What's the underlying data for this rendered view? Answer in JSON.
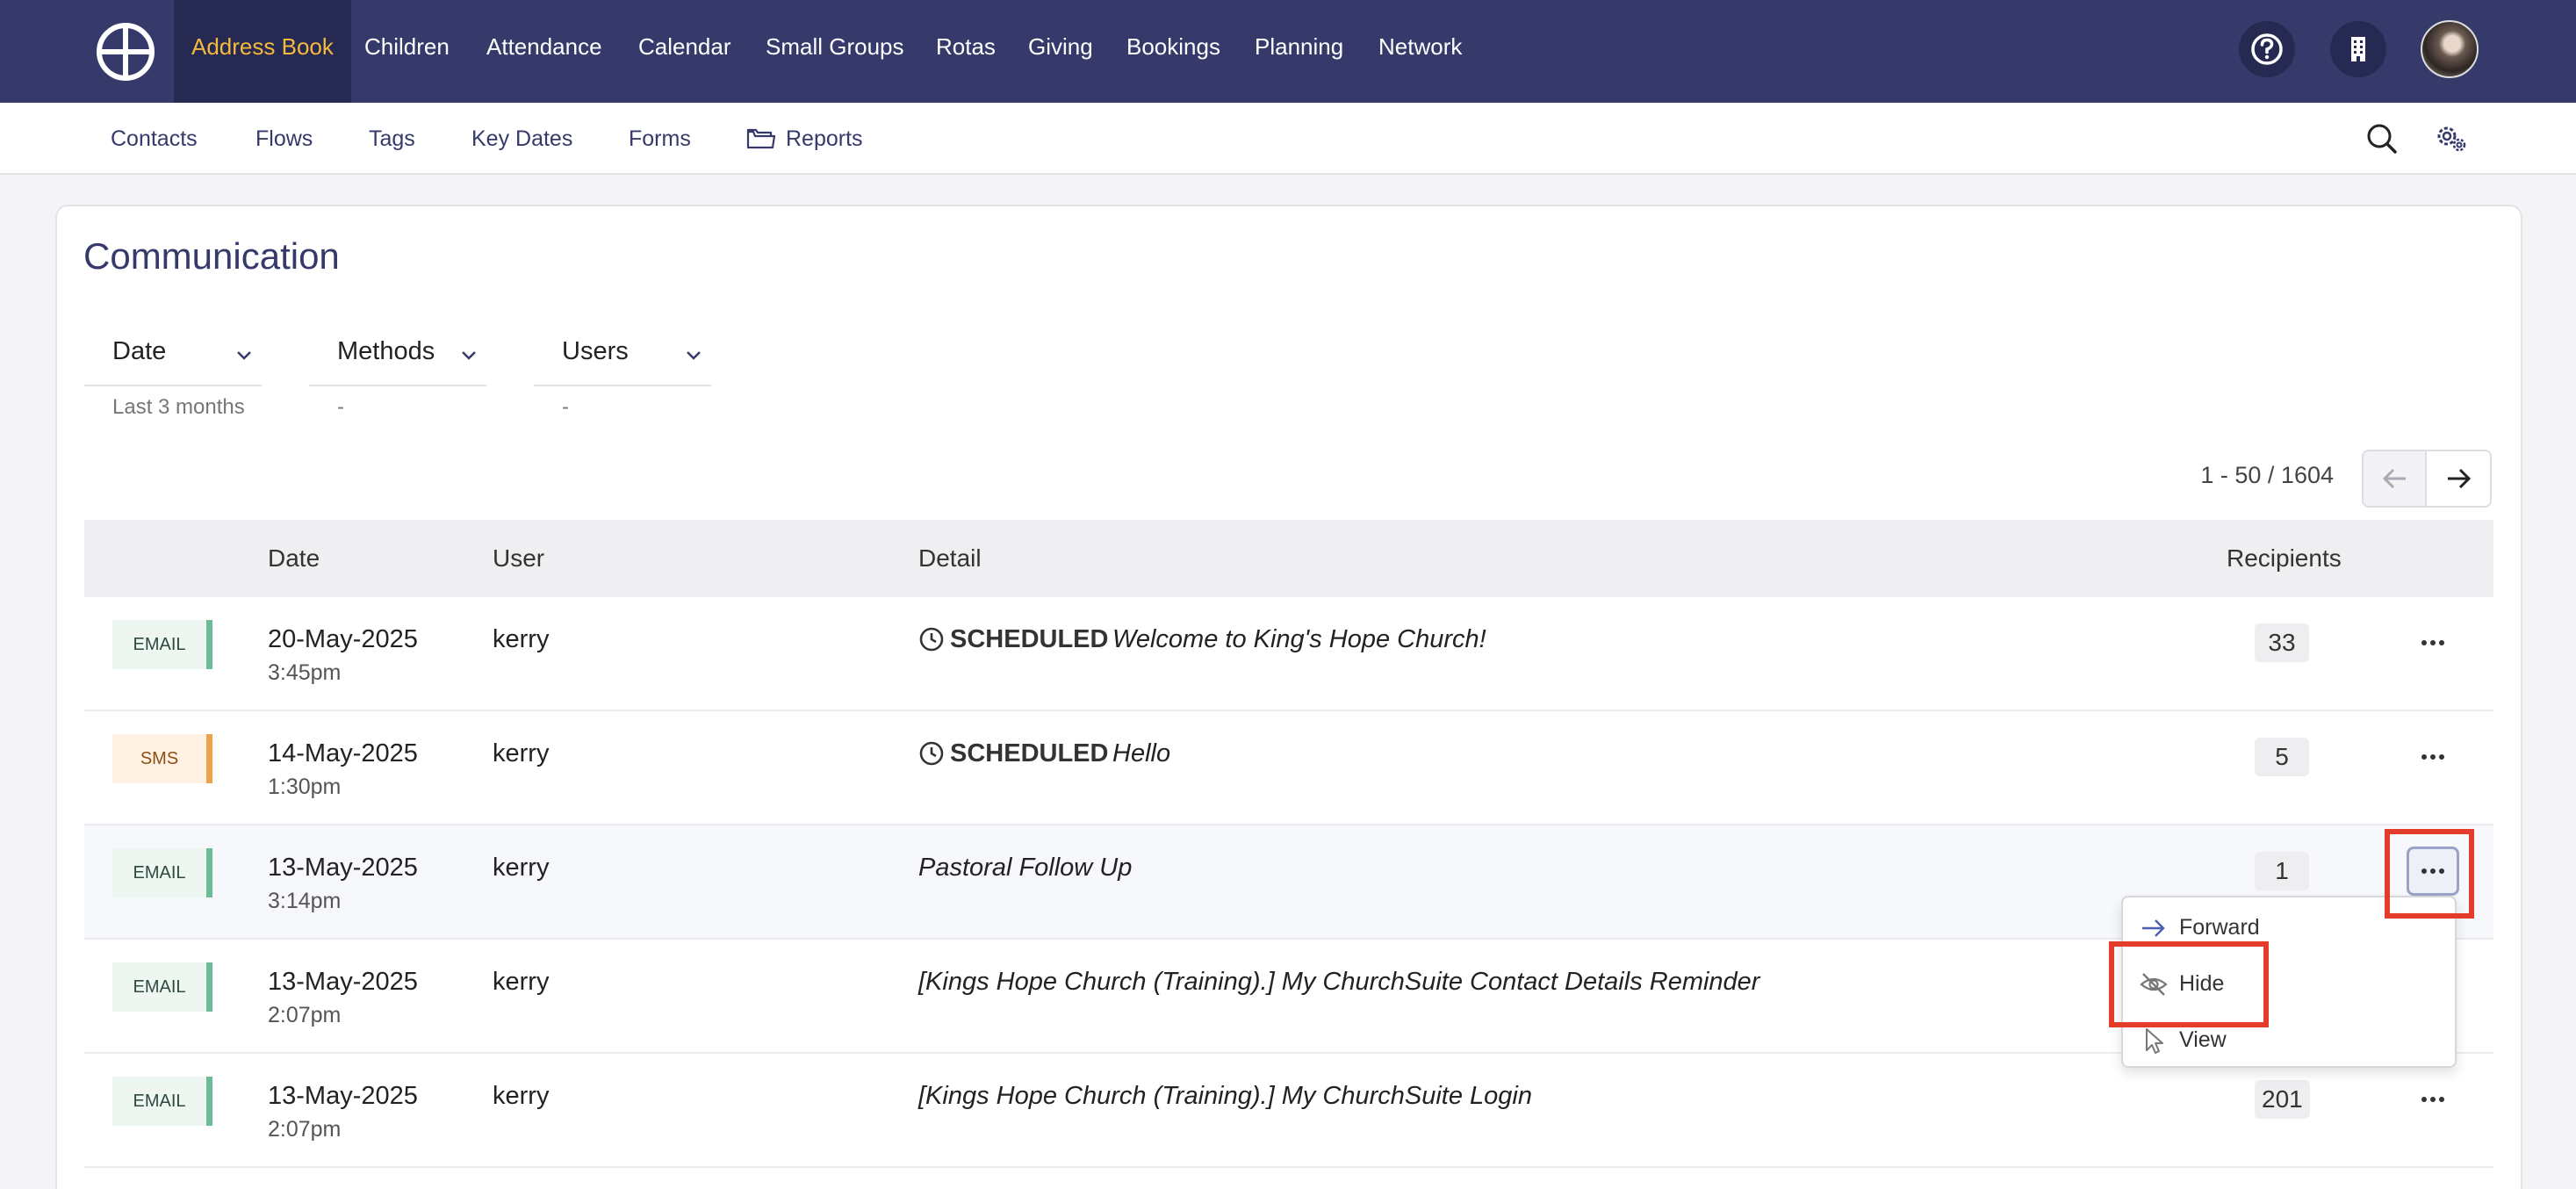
{
  "topnav": {
    "items": [
      {
        "label": "Address Book",
        "active": true
      },
      {
        "label": "Children"
      },
      {
        "label": "Attendance"
      },
      {
        "label": "Calendar"
      },
      {
        "label": "Small Groups"
      },
      {
        "label": "Rotas"
      },
      {
        "label": "Giving"
      },
      {
        "label": "Bookings"
      },
      {
        "label": "Planning"
      },
      {
        "label": "Network"
      }
    ],
    "icons": [
      "logo-icon",
      "help-icon",
      "building-icon",
      "avatar"
    ]
  },
  "subnav": {
    "items": [
      {
        "label": "Contacts"
      },
      {
        "label": "Flows"
      },
      {
        "label": "Tags"
      },
      {
        "label": "Key Dates"
      },
      {
        "label": "Forms"
      },
      {
        "label": "Reports"
      }
    ],
    "icons": [
      "folder-icon",
      "search-icon",
      "settings-icon"
    ]
  },
  "page": {
    "title": "Communication"
  },
  "filters": [
    {
      "label": "Date",
      "value": "Last 3 months"
    },
    {
      "label": "Methods",
      "value": "-"
    },
    {
      "label": "Users",
      "value": "-"
    }
  ],
  "pagination": {
    "text": "1 - 50 / 1604"
  },
  "table": {
    "headers": {
      "date": "Date",
      "user": "User",
      "detail": "Detail",
      "recipients": "Recipients"
    },
    "rows": [
      {
        "method": "EMAIL",
        "date": "20-May-2025",
        "time": "3:45pm",
        "user": "kerry",
        "status": "SCHEDULED",
        "detail": "Welcome to King's Hope Church!",
        "recipients": "33"
      },
      {
        "method": "SMS",
        "date": "14-May-2025",
        "time": "1:30pm",
        "user": "kerry",
        "status": "SCHEDULED",
        "detail": "Hello",
        "recipients": "5"
      },
      {
        "method": "EMAIL",
        "date": "13-May-2025",
        "time": "3:14pm",
        "user": "kerry",
        "status": "",
        "detail": "Pastoral Follow Up",
        "recipients": "1"
      },
      {
        "method": "EMAIL",
        "date": "13-May-2025",
        "time": "2:07pm",
        "user": "kerry",
        "status": "",
        "detail": "[Kings Hope Church (Training).] My ChurchSuite Contact Details Reminder",
        "recipients": ""
      },
      {
        "method": "EMAIL",
        "date": "13-May-2025",
        "time": "2:07pm",
        "user": "kerry",
        "status": "",
        "detail": "[Kings Hope Church (Training).] My ChurchSuite Login",
        "recipients": "201"
      }
    ]
  },
  "dropdown": {
    "items": [
      {
        "label": "Forward",
        "icon": "arrow-right-icon"
      },
      {
        "label": "Hide",
        "icon": "eye-slash-icon"
      },
      {
        "label": "View",
        "icon": "pointer-icon"
      }
    ]
  },
  "colors": {
    "nav_bg": "#353a6b",
    "nav_active_bg": "#262a52",
    "nav_active_text": "#f4b93d",
    "email_accent": "#6bbd98",
    "sms_accent": "#eea24a",
    "highlight_box": "#e53b2a"
  }
}
